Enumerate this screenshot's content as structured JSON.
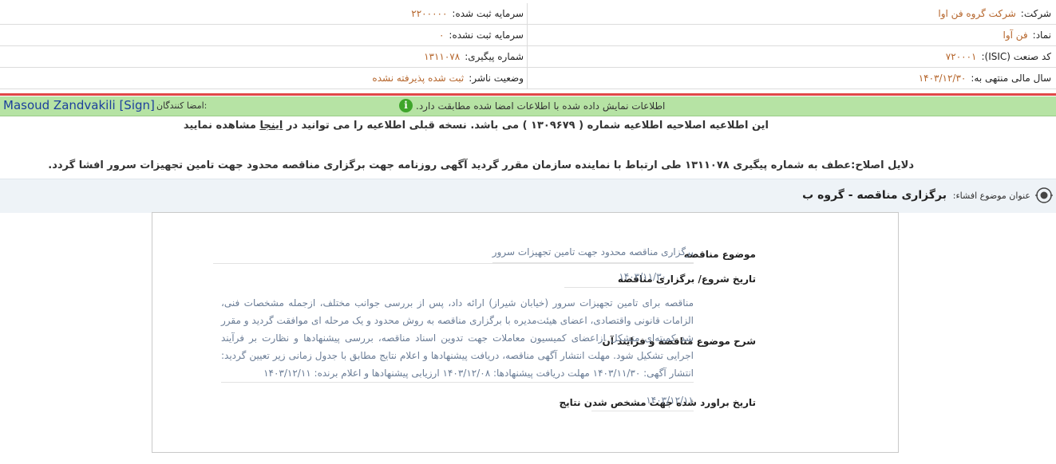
{
  "header": {
    "company_label": "شرکت:",
    "company_value": "شرکت گروه فن اوا",
    "registered_capital_label": "سرمایه ثبت شده:",
    "registered_capital_value": "۲۲۰۰۰۰۰",
    "symbol_label": "نماد:",
    "symbol_value": "فن آوا",
    "unregistered_capital_label": "سرمایه ثبت نشده:",
    "unregistered_capital_value": "۰",
    "isic_label": "کد صنعت (ISIC):",
    "isic_value": "۷۲۰۰۰۱",
    "tracking_label": "شماره پیگیری:",
    "tracking_value": "۱۳۱۱۰۷۸",
    "fiscal_year_label": "سال مالی منتهی به:",
    "fiscal_year_value": "۱۴۰۳/۱۲/۳۰",
    "publisher_status_label": "وضعیت ناشر:",
    "publisher_status_value": "ثبت شده پذیرفته نشده"
  },
  "signature": {
    "label": "امضا کنندگان:",
    "name": "Masoud Zandvakili [Sign]",
    "info_text": "اطلاعات نمایش داده شده با اطلاعات امضا شده مطابقت دارد.",
    "info_icon": "i"
  },
  "notices": {
    "correction_prefix": "این اطلاعیه اصلاحیه اطلاعیه شماره ( ۱۳۰۹۶۷۹ ) می باشد. نسخه قبلی اطلاعیه را می توانید در",
    "correction_link": "اینجا",
    "correction_suffix": "مشاهده نمایید",
    "reasons": "دلایل اصلاح:عطف به شماره پیگیری ۱۳۱۱۰۷۸ طی ارتباط با نماینده سازمان مقرر گردید آگهی روزنامه جهت برگزاری مناقصه محدود جهت تامین تجهیزات سرور افشا گردد."
  },
  "subject": {
    "label": "عنوان موضوع افشاء:",
    "title": "برگزاری مناقصه - گروه ب"
  },
  "details": {
    "tender_subject_label": "موضوع مناقصه",
    "tender_subject_value": "برگزاری مناقصه محدود جهت تامین تجهیزات سرور",
    "start_date_label": "تاریخ شروع/ برگزاری مناقصه",
    "start_date_value": "۱۴۰۳/۱۱/۳۰",
    "description_label": "شرح موضوع مناقصه و فرایند آن",
    "description_value": "مناقصه برای تامین تجهیزات سرور (خیابان شیراز) ارائه داد، پس از بررسی جوانب مختلف، ازجمله مشخصات فنی، الزامات قانونی واقتصادی، اعضای هیئت‌مدیره با برگزاری مناقصه به روش محدود و یک مرحله ای موافقت گردید و مقرر شد کمیته‌ای متشکل ازاعضای کمیسیون معاملات جهت تدوین اسناد مناقصه، بررسی پیشنهادها و نظارت بر فرآیند اجرایی تشکیل شود. مهلت انتشار آگهی مناقصه، دریافت پیشنهادها و اعلام نتایج مطابق با جدول زمانی زیر تعیین گردید: انتشار آگهی: ۱۴۰۳/۱۱/۳۰ مهلت دریافت پیشنهادها: ۱۴۰۳/۱۲/۰۸ ارزیابی پیشنهادها و اعلام برنده: ۱۴۰۳/۱۲/۱۱",
    "result_date_label": "تاریخ براورد شده جهت مشخص شدن نتایج",
    "result_date_value": "۱۴۰۳/۱۲/۱۱"
  },
  "colors": {
    "accent_value": "#b5652b",
    "sign_bar": "#b6e3a4",
    "red_line": "#e04747",
    "signer_name": "#1c3f9c",
    "detail_value": "#6b7d96"
  }
}
